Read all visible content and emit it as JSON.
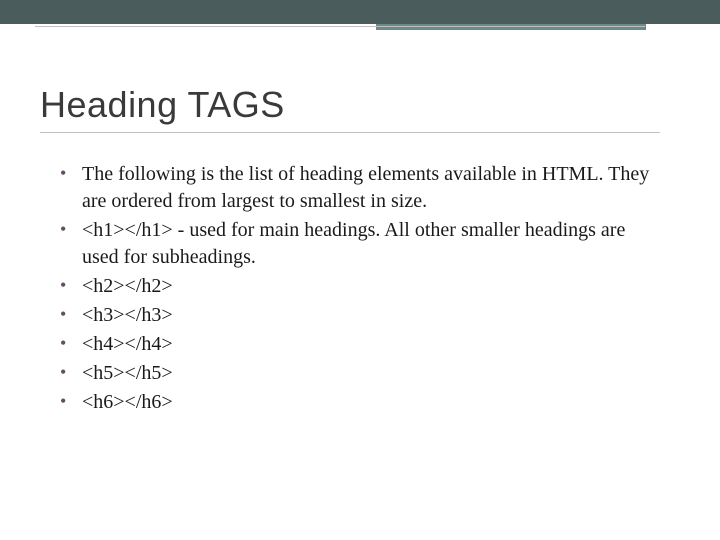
{
  "slide": {
    "title": "Heading TAGS",
    "bullets": [
      "The following is the list of heading elements available in HTML. They are ordered from largest to smallest in size.",
      "<h1></h1> - used for main headings. All other smaller headings are used for subheadings.",
      "<h2></h2>",
      "<h3></h3>",
      "<h4></h4>",
      "<h5></h5>",
      "<h6></h6>"
    ]
  }
}
